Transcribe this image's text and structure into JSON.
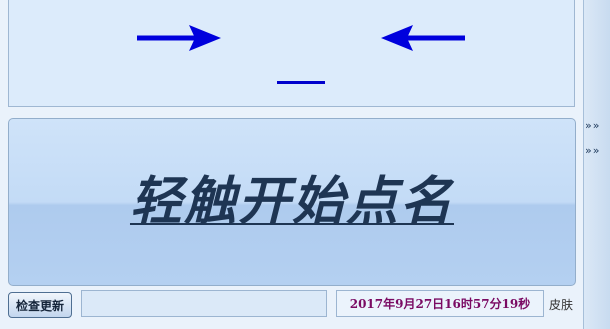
{
  "display": {
    "arrow_color": "#0000dd",
    "left_arrow_icon": "arrow-right-icon",
    "right_arrow_icon": "arrow-left-icon",
    "selected_name": "_"
  },
  "start_button": {
    "label": "轻触开始点名"
  },
  "side_controls": {
    "expand_1": "»»",
    "expand_2": "»»"
  },
  "bottom_bar": {
    "update_button": "检查更新",
    "status_value": "",
    "datetime": "2017年9月27日16时57分19秒",
    "skin_link": "皮肤"
  },
  "colors": {
    "datetime_text": "#7a0a63",
    "title_text": "#1e3553",
    "background": "#eaf2fb"
  }
}
